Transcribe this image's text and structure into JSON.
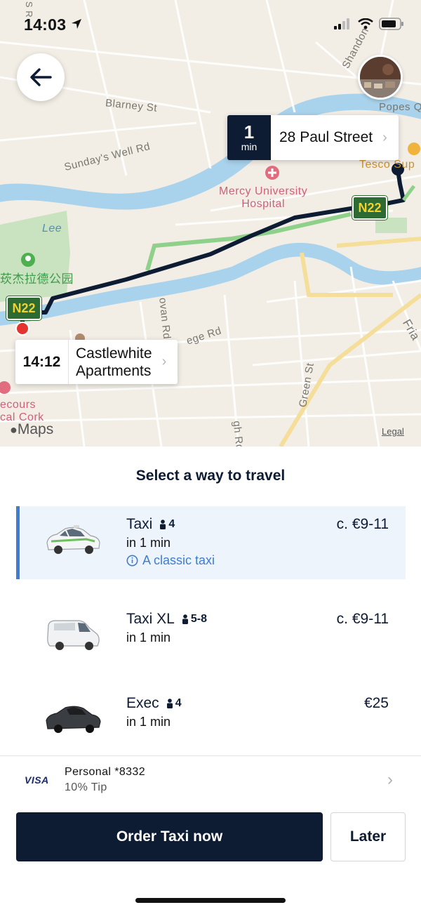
{
  "status_bar": {
    "time": "14:03"
  },
  "map": {
    "street_labels": [
      "Blarney St",
      "Sunday's Well Rd",
      "Shandon",
      "Lee",
      "Green St",
      "Fria",
      "Popes Q",
      "Tesco Sup",
      "ovan Rd",
      "ege Rd",
      "gh Rd",
      "S R"
    ],
    "poi_labels": {
      "hospital": "Mercy University\nHospital",
      "park": "莰杰拉德公园",
      "left_poi": "ecours\ncal Cork"
    },
    "road_shield": "N22",
    "destination": {
      "minutes": "1",
      "unit": "min",
      "address": "28 Paul Street"
    },
    "origin": {
      "time": "14:12",
      "address_line1": "Castlewhite",
      "address_line2": "Apartments"
    },
    "attribution": "Maps",
    "legal": "Legal"
  },
  "sheet": {
    "title": "Select a way to travel",
    "options": [
      {
        "name": "Taxi",
        "pax": "4",
        "eta": "in 1 min",
        "info": "A classic taxi",
        "price": "c. €9-11",
        "selected": true
      },
      {
        "name": "Taxi XL",
        "pax": "5-8",
        "eta": "in 1 min",
        "price": "c. €9-11",
        "selected": false
      },
      {
        "name": "Exec",
        "pax": "4",
        "eta": "in 1 min",
        "price": "€25",
        "selected": false
      }
    ]
  },
  "payment": {
    "card_brand": "VISA",
    "name": "Personal *8332",
    "tip": "10% Tip"
  },
  "actions": {
    "order": "Order Taxi now",
    "later": "Later"
  },
  "colors": {
    "navy": "#0d1b33",
    "accent_blue": "#3f7dd0",
    "selected_bg": "#edf4fc",
    "route": "#0d1b33",
    "road_shield_green": "#2e6b33"
  }
}
